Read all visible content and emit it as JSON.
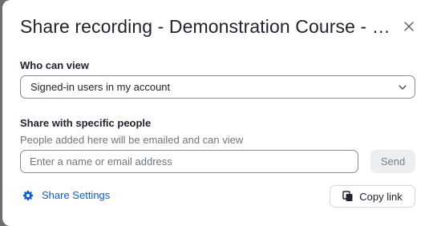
{
  "dialog": {
    "title": "Share recording - Demonstration Course - Recording",
    "close_icon": "close-icon"
  },
  "who_can_view": {
    "label": "Who can view",
    "selected": "Signed-in users in my account",
    "chevron_icon": "chevron-down-icon"
  },
  "share_people": {
    "label": "Share with specific people",
    "helper": "People added here will be emailed and can view",
    "input_placeholder": "Enter a name or email address",
    "input_value": "",
    "send_label": "Send"
  },
  "footer": {
    "settings_label": "Share Settings",
    "settings_icon": "gear-icon",
    "copy_label": "Copy link",
    "copy_icon": "copy-icon"
  },
  "colors": {
    "link": "#0b5cd5",
    "text": "#222230",
    "muted": "#6e7680",
    "backdrop": "#6e6e6e"
  }
}
